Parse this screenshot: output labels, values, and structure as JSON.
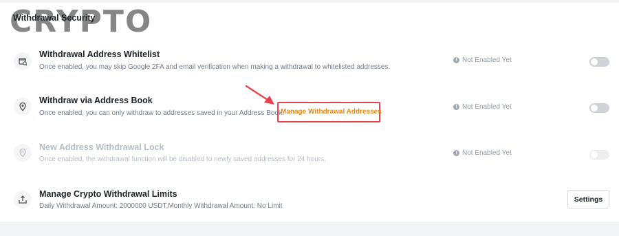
{
  "section": {
    "title": "Withdrawal Security"
  },
  "watermark": {
    "text": "CRYPTO"
  },
  "rows": [
    {
      "title": "Withdrawal Address Whitelist",
      "description": "Once enabled, you may skip Google 2FA and email verification when making a withdrawal to whitelisted addresses.",
      "status": "Not Enabled Yet",
      "icon": "address-whitelist-icon",
      "enabled": false
    },
    {
      "title": "Withdraw via Address Book",
      "description": "Once enabled, you can only withdraw to addresses saved in your Address Book.",
      "link": "Manage Withdrawal Addresses",
      "status": "Not Enabled Yet",
      "icon": "location-pin-icon",
      "enabled": false
    },
    {
      "title": "New Address Withdrawal Lock",
      "description": "Once enabled, the withdrawal function will be disabled to newly saved addresses for 24 hours.",
      "status": "Not Enabled Yet",
      "icon": "new-address-lock-icon",
      "enabled": false,
      "disabled": true
    },
    {
      "title": "Manage Crypto Withdrawal Limits",
      "description": "Daily Withdrawal Amount: 2000000 USDT,Monthly Withdrawal Amount: No Limit",
      "button": "Settings",
      "icon": "upload-tray-icon"
    }
  ],
  "colors": {
    "accent_link": "#e8891d",
    "highlight_red": "#e8424f",
    "toggle_off": "#cfd3d8"
  }
}
